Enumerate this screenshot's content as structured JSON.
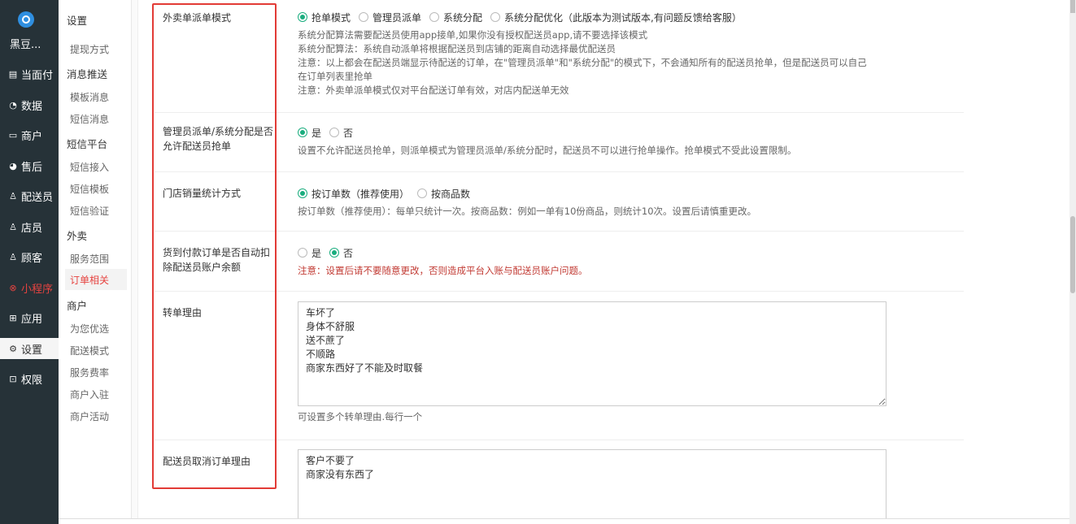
{
  "nav": {
    "brand": "黑豆...",
    "items": [
      {
        "label": "当面付",
        "icon": "receipt-icon"
      },
      {
        "label": "数据",
        "icon": "chart-icon"
      },
      {
        "label": "商户",
        "icon": "store-icon"
      },
      {
        "label": "售后",
        "icon": "after-sales-icon"
      },
      {
        "label": "配送员",
        "icon": "courier-icon"
      },
      {
        "label": "店员",
        "icon": "clerk-icon"
      },
      {
        "label": "顾客",
        "icon": "customer-icon"
      },
      {
        "label": "小程序",
        "icon": "miniprogram-icon"
      },
      {
        "label": "应用",
        "icon": "apps-icon"
      },
      {
        "label": "设置",
        "icon": "gear-icon"
      },
      {
        "label": "权限",
        "icon": "lock-icon"
      }
    ]
  },
  "submenu": {
    "items": [
      {
        "label": "设置",
        "type": "group"
      },
      {
        "label": "提现方式",
        "type": "item"
      },
      {
        "label": "消息推送",
        "type": "group"
      },
      {
        "label": "模板消息",
        "type": "item"
      },
      {
        "label": "短信消息",
        "type": "item"
      },
      {
        "label": "短信平台",
        "type": "group"
      },
      {
        "label": "短信接入",
        "type": "item"
      },
      {
        "label": "短信模板",
        "type": "item"
      },
      {
        "label": "短信验证",
        "type": "item"
      },
      {
        "label": "外卖",
        "type": "group"
      },
      {
        "label": "服务范围",
        "type": "item"
      },
      {
        "label": "订单相关",
        "type": "active"
      },
      {
        "label": "商户",
        "type": "group"
      },
      {
        "label": "为您优选",
        "type": "item"
      },
      {
        "label": "配送模式",
        "type": "item"
      },
      {
        "label": "服务费率",
        "type": "item"
      },
      {
        "label": "商户入驻",
        "type": "item"
      },
      {
        "label": "商户活动",
        "type": "item"
      }
    ]
  },
  "form": {
    "dispatch": {
      "label": "外卖单派单模式",
      "options": [
        "抢单模式",
        "管理员派单",
        "系统分配",
        "系统分配优化（此版本为测试版本,有问题反馈给客服）"
      ],
      "selected": 0,
      "help": [
        "系统分配算法需要配送员使用app接单,如果你没有授权配送员app,请不要选择该模式",
        "系统分配算法：系统自动派单将根据配送员到店铺的距离自动选择最优配送员",
        "注意：以上都会在配送员端显示待配送的订单，在\"管理员派单\"和\"系统分配\"的模式下，不会通知所有的配送员抢单，但是配送员可以自己",
        "在订单列表里抢单",
        "注意：外卖单派单模式仅对平台配送订单有效，对店内配送单无效"
      ]
    },
    "grab": {
      "label": "管理员派单/系统分配是否允许配送员抢单",
      "options": [
        "是",
        "否"
      ],
      "selected": 0,
      "help": "设置不允许配送员抢单，则派单模式为管理员派单/系统分配时，配送员不可以进行抢单操作。抢单模式不受此设置限制。"
    },
    "stats": {
      "label": "门店销量统计方式",
      "options": [
        "按订单数（推荐使用）",
        "按商品数"
      ],
      "selected": 0,
      "help": "按订单数（推荐使用）：每单只统计一次。按商品数：例如一单有10份商品，则统计10次。设置后请慎重更改。"
    },
    "cod": {
      "label": "货到付款订单是否自动扣除配送员账户余额",
      "options": [
        "是",
        "否"
      ],
      "selected": 1,
      "help": "注意：设置后请不要随意更改，否则造成平台入账与配送员账户问题。"
    },
    "transfer": {
      "label": "转单理由",
      "value": "车坏了\n身体不舒服\n送不蔗了\n不顺路\n商家东西好了不能及时取餐",
      "help": "可设置多个转单理由.每行一个"
    },
    "cancel": {
      "label": "配送员取消订单理由",
      "value": "客户不要了\n商家没有东西了"
    }
  }
}
